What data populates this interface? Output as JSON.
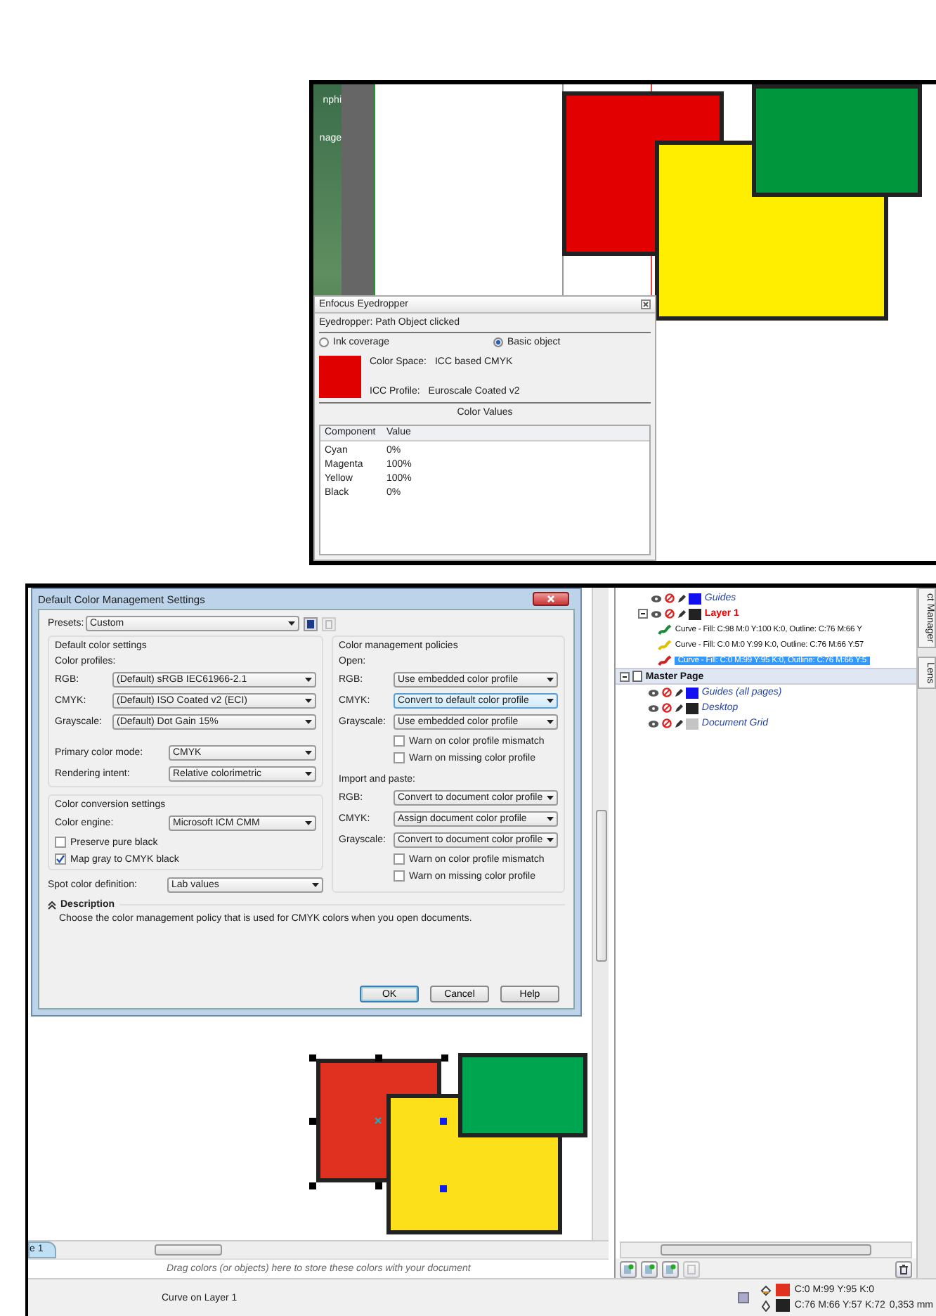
{
  "top_screenshot": {
    "desktop_labels": [
      "nphi",
      "nage"
    ],
    "eyedropper": {
      "title": "Enfocus Eyedropper",
      "status": "Eyedropper: Path Object clicked",
      "modes": [
        {
          "label": "Ink coverage",
          "selected": false
        },
        {
          "label": "Basic object",
          "selected": true
        }
      ],
      "color_space": {
        "label": "Color Space:",
        "value": "ICC based CMYK"
      },
      "icc_profile": {
        "label": "ICC Profile:",
        "value": "Euroscale Coated v2"
      },
      "values_title": "Color Values",
      "columns": [
        "Component",
        "Value"
      ],
      "rows": [
        [
          "Cyan",
          "0%"
        ],
        [
          "Magenta",
          "100%"
        ],
        [
          "Yellow",
          "100%"
        ],
        [
          "Black",
          "0%"
        ]
      ]
    }
  },
  "bottom_screenshot": {
    "dialog": {
      "title": "Default Color Management Settings",
      "presets": {
        "label": "Presets:",
        "value": "Custom"
      },
      "default_group": {
        "title": "Default color settings",
        "profiles_label": "Color profiles:",
        "profiles": [
          {
            "label": "RGB:",
            "value": "(Default) sRGB IEC61966-2.1"
          },
          {
            "label": "CMYK:",
            "value": "(Default) ISO Coated v2 (ECI)"
          },
          {
            "label": "Grayscale:",
            "value": "(Default) Dot Gain 15%"
          }
        ],
        "modes": [
          {
            "label": "Primary color mode:",
            "value": "CMYK"
          },
          {
            "label": "Rendering intent:",
            "value": "Relative colorimetric"
          }
        ]
      },
      "conversion_group": {
        "title": "Color conversion settings",
        "engine": {
          "label": "Color engine:",
          "value": "Microsoft ICM CMM"
        },
        "checks": [
          {
            "label": "Preserve pure black",
            "checked": false
          },
          {
            "label": "Map gray to CMYK black",
            "checked": true
          }
        ]
      },
      "spot": {
        "label": "Spot color definition:",
        "value": "Lab values"
      },
      "policies": {
        "title": "Color management policies",
        "sections": [
          {
            "title": "Open:",
            "rows": [
              {
                "label": "RGB:",
                "value": "Use embedded color profile",
                "focused": false
              },
              {
                "label": "CMYK:",
                "value": "Convert to default color profile",
                "focused": true
              },
              {
                "label": "Grayscale:",
                "value": "Use embedded color profile",
                "focused": false
              }
            ],
            "checks": [
              {
                "label": "Warn on color profile mismatch",
                "checked": false
              },
              {
                "label": "Warn on missing color profile",
                "checked": false
              }
            ]
          },
          {
            "title": "Import and paste:",
            "rows": [
              {
                "label": "RGB:",
                "value": "Convert to document color profile",
                "focused": false
              },
              {
                "label": "CMYK:",
                "value": "Assign document color profile",
                "focused": false
              },
              {
                "label": "Grayscale:",
                "value": "Convert to document color profile",
                "focused": false
              }
            ],
            "checks": [
              {
                "label": "Warn on color profile mismatch",
                "checked": false
              },
              {
                "label": "Warn on missing color profile",
                "checked": false
              }
            ]
          }
        ]
      },
      "description": {
        "title": "Description",
        "expanded": true,
        "text": "Choose the color management policy that is used for CMYK colors when you open documents."
      },
      "buttons": [
        {
          "label": "OK",
          "default": true
        },
        {
          "label": "Cancel",
          "default": false
        },
        {
          "label": "Help",
          "default": false
        }
      ]
    },
    "object_manager": {
      "layers": [
        {
          "label": "Guides",
          "active": false,
          "color": "#1010f0"
        },
        {
          "label": "Layer 1",
          "active": true,
          "color": "#222222",
          "expanded": true,
          "children": [
            {
              "label": "Curve - Fill: C:98 M:0 Y:100 K:0, Outline: C:76 M:66 Y",
              "color": "#1d8a3a",
              "selected": false
            },
            {
              "label": "Curve - Fill: C:0 M:0 Y:99 K:0, Outline: C:76 M:66 Y:57",
              "color": "#e0c000",
              "selected": false
            },
            {
              "label": "Curve - Fill: C:0 M:99 Y:95 K:0, Outline: C:76 M:66 Y:5",
              "color": "#d02020",
              "selected": true
            }
          ]
        }
      ],
      "master_page": {
        "label": "Master Page",
        "expanded": true,
        "children": [
          {
            "label": "Guides (all pages)",
            "color": "#1010f0"
          },
          {
            "label": "Desktop",
            "color": "#222222"
          },
          {
            "label": "Document Grid",
            "color": "#c4c4c4"
          }
        ]
      }
    },
    "side_tabs": [
      "ct Manager",
      "Lens"
    ],
    "page_tab": "e 1",
    "palette_hint": "Drag colors (or objects) here to store these colors with your document",
    "status": {
      "message": "Curve on Layer 1",
      "fill": "C:0 M:99 Y:95 K:0",
      "outline": "C:76 M:66 Y:57 K:72",
      "outline_width": "0,353 mm"
    }
  }
}
